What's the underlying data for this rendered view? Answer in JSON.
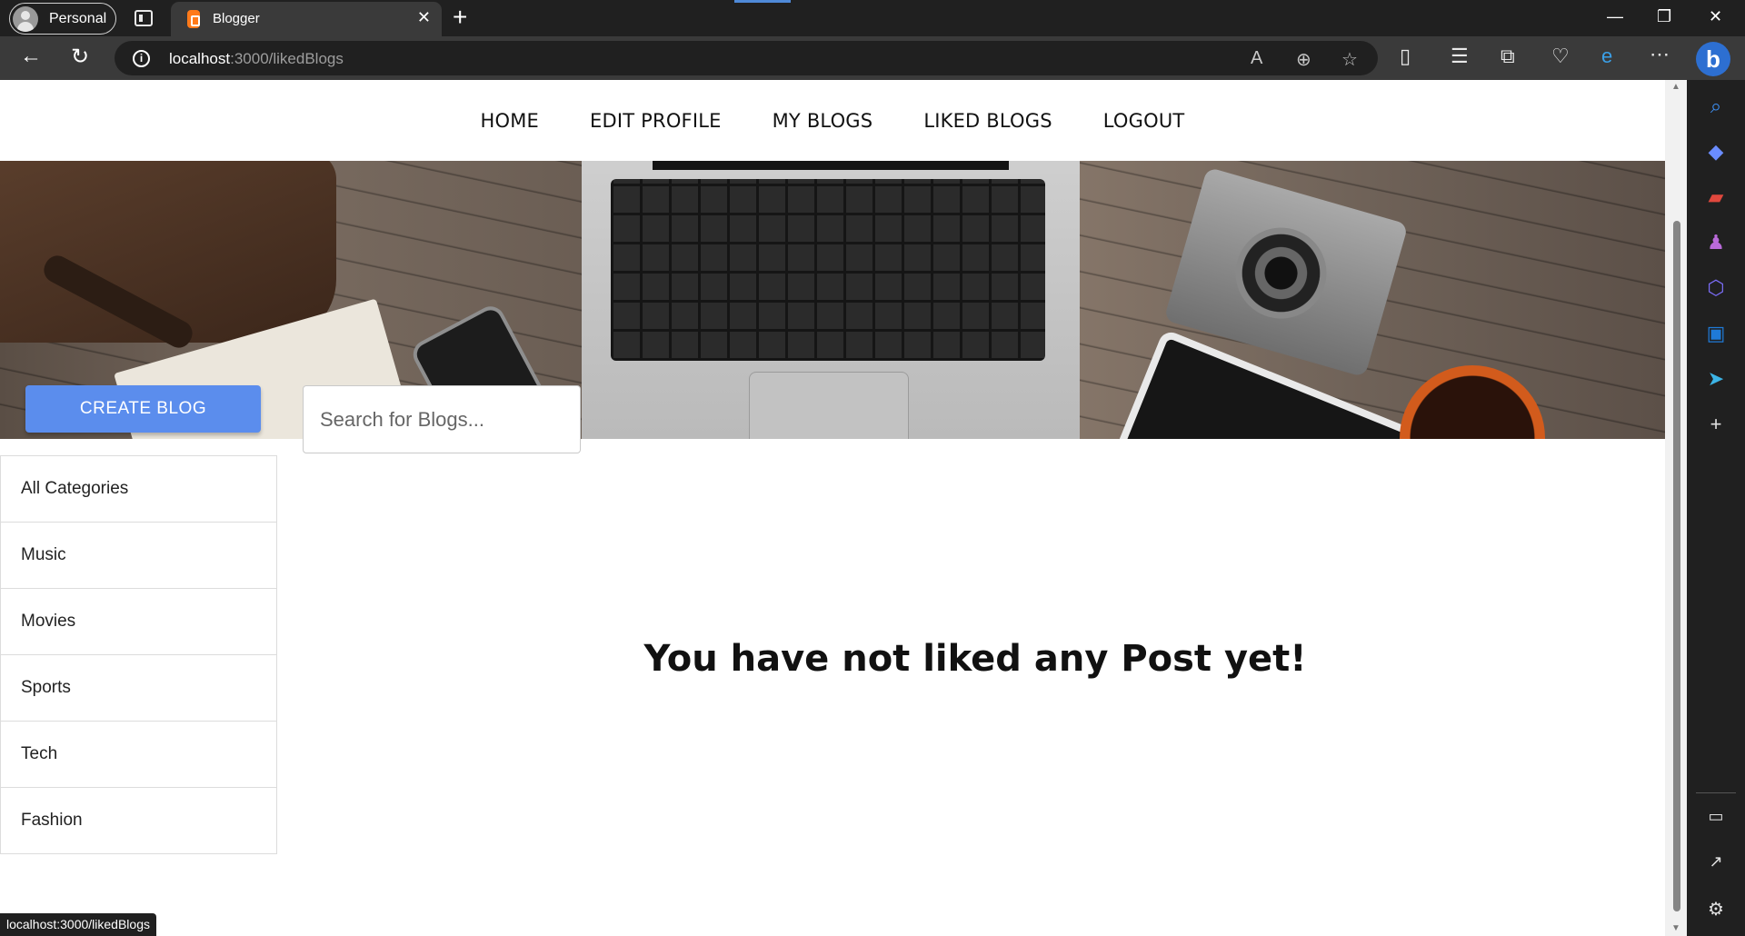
{
  "browser": {
    "profile_label": "Personal",
    "tab_title": "Blogger",
    "tab_close": "✕",
    "new_tab": "+",
    "url_host": "localhost",
    "url_path": ":3000/likedBlogs",
    "status_url": "localhost:3000/likedBlogs"
  },
  "nav": {
    "home": "HOME",
    "edit_profile": "EDIT PROFILE",
    "my_blogs": "MY BLOGS",
    "liked_blogs": "LIKED BLOGS",
    "logout": "LOGOUT"
  },
  "actions": {
    "create_blog": "CREATE BLOG"
  },
  "search": {
    "placeholder": "Search for Blogs..."
  },
  "categories": [
    "All Categories",
    "Music",
    "Movies",
    "Sports",
    "Tech",
    "Fashion"
  ],
  "main": {
    "empty_message": "You have not liked any Post yet!"
  },
  "colors": {
    "accent": "#5b8ded"
  }
}
